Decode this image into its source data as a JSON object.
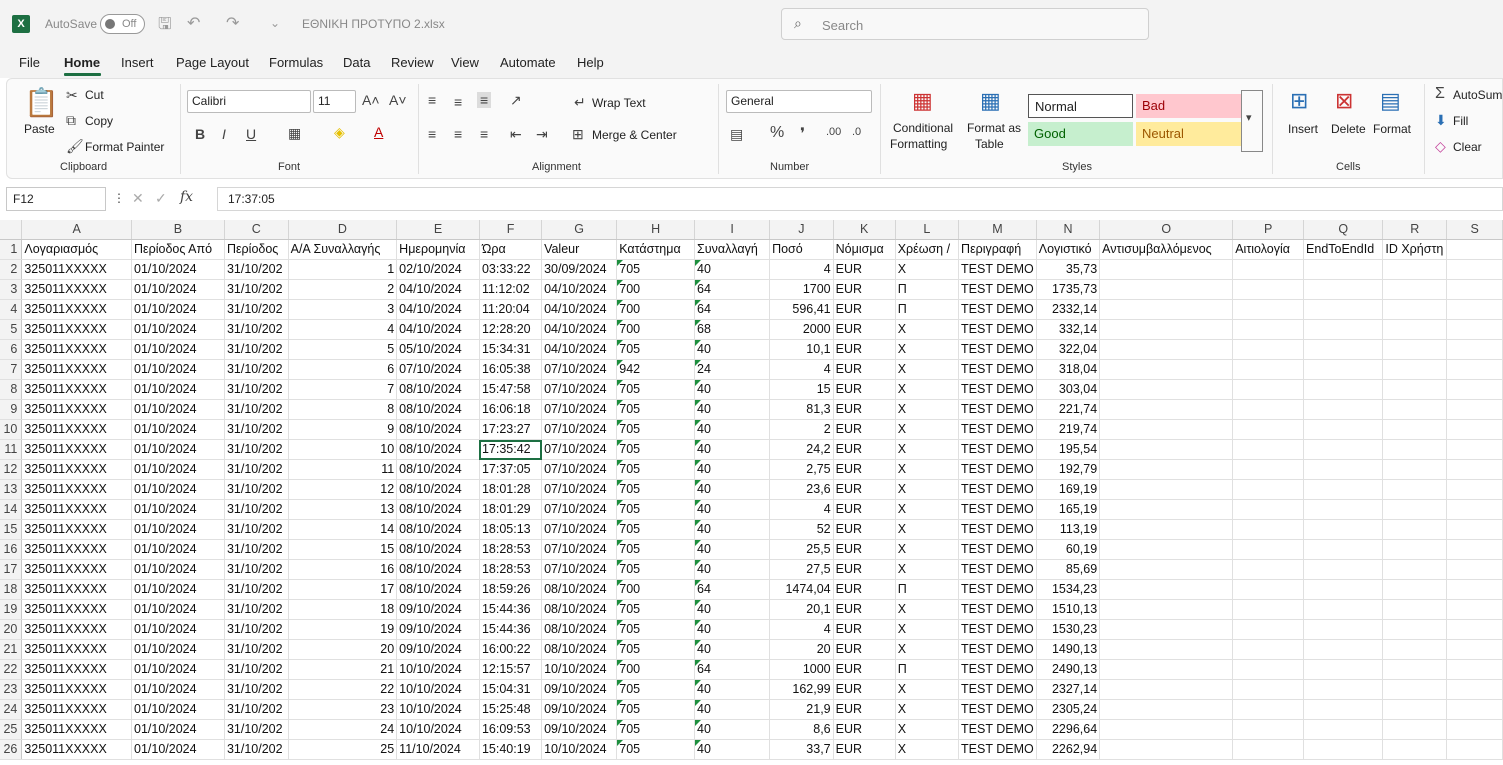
{
  "titlebar": {
    "autosave_label": "AutoSave",
    "autosave_state": "Off",
    "filename": "ΕΘΝΙΚΗ ΠΡΟΤΥΠΟ 2.xlsx",
    "search_placeholder": "Search"
  },
  "menu": [
    "File",
    "Home",
    "Insert",
    "Page Layout",
    "Formulas",
    "Data",
    "Review",
    "View",
    "Automate",
    "Help"
  ],
  "ribbon": {
    "clipboard": {
      "paste": "Paste",
      "cut": "Cut",
      "copy": "Copy",
      "format_painter": "Format Painter",
      "group": "Clipboard"
    },
    "font": {
      "name": "Calibri",
      "size": "11",
      "group": "Font"
    },
    "alignment": {
      "wrap": "Wrap Text",
      "merge": "Merge & Center",
      "group": "Alignment"
    },
    "number": {
      "format": "General",
      "group": "Number"
    },
    "styles": {
      "conditional": "Conditional",
      "conditional2": "Formatting",
      "format_as": "Format as",
      "table": "Table",
      "normal": "Normal",
      "bad": "Bad",
      "good": "Good",
      "neutral": "Neutral",
      "group": "Styles"
    },
    "cells": {
      "insert": "Insert",
      "delete": "Delete",
      "format": "Format",
      "group": "Cells"
    },
    "editing": {
      "autosum": "AutoSum",
      "fill": "Fill",
      "clear": "Clear"
    }
  },
  "formula_bar": {
    "cell_ref": "F12",
    "fx": "fx",
    "value": "17:37:05"
  },
  "columns": [
    "A",
    "B",
    "C",
    "D",
    "E",
    "F",
    "G",
    "H",
    "I",
    "J",
    "K",
    "L",
    "M",
    "N",
    "O",
    "P",
    "Q",
    "R",
    "S"
  ],
  "headers": [
    "Λογαριασμός",
    "Περίοδος Από",
    "Περίοδος",
    "Α/Α Συναλλαγής",
    "Ημερομηνία",
    "Ώρα",
    "Valeur",
    "Κατάστημα",
    "Συναλλαγή",
    "Ποσό",
    "Νόμισμα",
    "Χρέωση /",
    "Περιγραφή",
    "Λογιστικό",
    "Αντισυμβαλλόμενος",
    "Αιτιολογία",
    "EndToEndId",
    "ID Χρήστη",
    ""
  ],
  "rows": [
    [
      "325011XXXXX",
      "01/10/2024",
      "31/10/202",
      "1",
      "02/10/2024",
      "03:33:22",
      "30/09/2024",
      "705",
      "40",
      "4",
      "EUR",
      "Χ",
      "TEST DEMO",
      "35,73"
    ],
    [
      "325011XXXXX",
      "01/10/2024",
      "31/10/202",
      "2",
      "04/10/2024",
      "11:12:02",
      "04/10/2024",
      "700",
      "64",
      "1700",
      "EUR",
      "Π",
      "TEST DEMO",
      "1735,73"
    ],
    [
      "325011XXXXX",
      "01/10/2024",
      "31/10/202",
      "3",
      "04/10/2024",
      "11:20:04",
      "04/10/2024",
      "700",
      "64",
      "596,41",
      "EUR",
      "Π",
      "TEST DEMO",
      "2332,14"
    ],
    [
      "325011XXXXX",
      "01/10/2024",
      "31/10/202",
      "4",
      "04/10/2024",
      "12:28:20",
      "04/10/2024",
      "700",
      "68",
      "2000",
      "EUR",
      "Χ",
      "TEST DEMO",
      "332,14"
    ],
    [
      "325011XXXXX",
      "01/10/2024",
      "31/10/202",
      "5",
      "05/10/2024",
      "15:34:31",
      "04/10/2024",
      "705",
      "40",
      "10,1",
      "EUR",
      "Χ",
      "TEST DEMO",
      "322,04"
    ],
    [
      "325011XXXXX",
      "01/10/2024",
      "31/10/202",
      "6",
      "07/10/2024",
      "16:05:38",
      "07/10/2024",
      "942",
      "24",
      "4",
      "EUR",
      "Χ",
      "TEST DEMO",
      "318,04"
    ],
    [
      "325011XXXXX",
      "01/10/2024",
      "31/10/202",
      "7",
      "08/10/2024",
      "15:47:58",
      "07/10/2024",
      "705",
      "40",
      "15",
      "EUR",
      "Χ",
      "TEST DEMO",
      "303,04"
    ],
    [
      "325011XXXXX",
      "01/10/2024",
      "31/10/202",
      "8",
      "08/10/2024",
      "16:06:18",
      "07/10/2024",
      "705",
      "40",
      "81,3",
      "EUR",
      "Χ",
      "TEST DEMO",
      "221,74"
    ],
    [
      "325011XXXXX",
      "01/10/2024",
      "31/10/202",
      "9",
      "08/10/2024",
      "17:23:27",
      "07/10/2024",
      "705",
      "40",
      "2",
      "EUR",
      "Χ",
      "TEST DEMO",
      "219,74"
    ],
    [
      "325011XXXXX",
      "01/10/2024",
      "31/10/202",
      "10",
      "08/10/2024",
      "17:35:42",
      "07/10/2024",
      "705",
      "40",
      "24,2",
      "EUR",
      "Χ",
      "TEST DEMO",
      "195,54"
    ],
    [
      "325011XXXXX",
      "01/10/2024",
      "31/10/202",
      "11",
      "08/10/2024",
      "17:37:05",
      "07/10/2024",
      "705",
      "40",
      "2,75",
      "EUR",
      "Χ",
      "TEST DEMO",
      "192,79"
    ],
    [
      "325011XXXXX",
      "01/10/2024",
      "31/10/202",
      "12",
      "08/10/2024",
      "18:01:28",
      "07/10/2024",
      "705",
      "40",
      "23,6",
      "EUR",
      "Χ",
      "TEST DEMO",
      "169,19"
    ],
    [
      "325011XXXXX",
      "01/10/2024",
      "31/10/202",
      "13",
      "08/10/2024",
      "18:01:29",
      "07/10/2024",
      "705",
      "40",
      "4",
      "EUR",
      "Χ",
      "TEST DEMO",
      "165,19"
    ],
    [
      "325011XXXXX",
      "01/10/2024",
      "31/10/202",
      "14",
      "08/10/2024",
      "18:05:13",
      "07/10/2024",
      "705",
      "40",
      "52",
      "EUR",
      "Χ",
      "TEST DEMO",
      "113,19"
    ],
    [
      "325011XXXXX",
      "01/10/2024",
      "31/10/202",
      "15",
      "08/10/2024",
      "18:28:53",
      "07/10/2024",
      "705",
      "40",
      "25,5",
      "EUR",
      "Χ",
      "TEST DEMO",
      "60,19"
    ],
    [
      "325011XXXXX",
      "01/10/2024",
      "31/10/202",
      "16",
      "08/10/2024",
      "18:28:53",
      "07/10/2024",
      "705",
      "40",
      "27,5",
      "EUR",
      "Χ",
      "TEST DEMO",
      "85,69"
    ],
    [
      "325011XXXXX",
      "01/10/2024",
      "31/10/202",
      "17",
      "08/10/2024",
      "18:59:26",
      "08/10/2024",
      "700",
      "64",
      "1474,04",
      "EUR",
      "Π",
      "TEST DEMO",
      "1534,23"
    ],
    [
      "325011XXXXX",
      "01/10/2024",
      "31/10/202",
      "18",
      "09/10/2024",
      "15:44:36",
      "08/10/2024",
      "705",
      "40",
      "20,1",
      "EUR",
      "Χ",
      "TEST DEMO",
      "1510,13"
    ],
    [
      "325011XXXXX",
      "01/10/2024",
      "31/10/202",
      "19",
      "09/10/2024",
      "15:44:36",
      "08/10/2024",
      "705",
      "40",
      "4",
      "EUR",
      "Χ",
      "TEST DEMO",
      "1530,23"
    ],
    [
      "325011XXXXX",
      "01/10/2024",
      "31/10/202",
      "20",
      "09/10/2024",
      "16:00:22",
      "08/10/2024",
      "705",
      "40",
      "20",
      "EUR",
      "Χ",
      "TEST DEMO",
      "1490,13"
    ],
    [
      "325011XXXXX",
      "01/10/2024",
      "31/10/202",
      "21",
      "10/10/2024",
      "12:15:57",
      "10/10/2024",
      "700",
      "64",
      "1000",
      "EUR",
      "Π",
      "TEST DEMO",
      "2490,13"
    ],
    [
      "325011XXXXX",
      "01/10/2024",
      "31/10/202",
      "22",
      "10/10/2024",
      "15:04:31",
      "09/10/2024",
      "705",
      "40",
      "162,99",
      "EUR",
      "Χ",
      "TEST DEMO",
      "2327,14"
    ],
    [
      "325011XXXXX",
      "01/10/2024",
      "31/10/202",
      "23",
      "10/10/2024",
      "15:25:48",
      "09/10/2024",
      "705",
      "40",
      "21,9",
      "EUR",
      "Χ",
      "TEST DEMO",
      "2305,24"
    ],
    [
      "325011XXXXX",
      "01/10/2024",
      "31/10/202",
      "24",
      "10/10/2024",
      "16:09:53",
      "09/10/2024",
      "705",
      "40",
      "8,6",
      "EUR",
      "Χ",
      "TEST DEMO",
      "2296,64"
    ],
    [
      "325011XXXXX",
      "01/10/2024",
      "31/10/202",
      "25",
      "11/10/2024",
      "15:40:19",
      "10/10/2024",
      "705",
      "40",
      "33,7",
      "EUR",
      "Χ",
      "TEST DEMO",
      "2262,94"
    ]
  ],
  "selected_cell": {
    "row": 11,
    "col": 5
  }
}
